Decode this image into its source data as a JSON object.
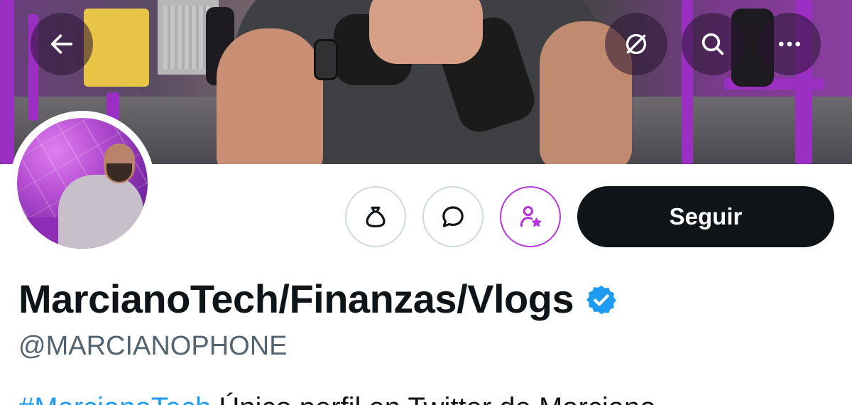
{
  "header": {
    "back_icon": "arrow-left-icon",
    "grok_icon": "slashed-circle-icon",
    "search_icon": "search-icon",
    "more_icon": "ellipsis-icon"
  },
  "profile": {
    "display_name": "MarcianoTech/Finanzas/Vlogs",
    "verified_icon": "verified-badge-icon",
    "verified_color": "#1d9bf0",
    "handle": "@MARCIANOPHONE",
    "bio_hashtag": "#MarcianoTech",
    "bio_text": " Único perfil en Twitter de Marciano"
  },
  "actions": {
    "tip_icon": "money-bag-icon",
    "message_icon": "chat-bubble-icon",
    "subscribe_icon": "person-star-icon",
    "subscribe_color": "#b538d6",
    "follow_label": "Seguir"
  },
  "colors": {
    "text_primary": "#0f1419",
    "text_secondary": "#536471",
    "button_dark": "#0f1419",
    "accent_link": "#1d9bf0"
  }
}
